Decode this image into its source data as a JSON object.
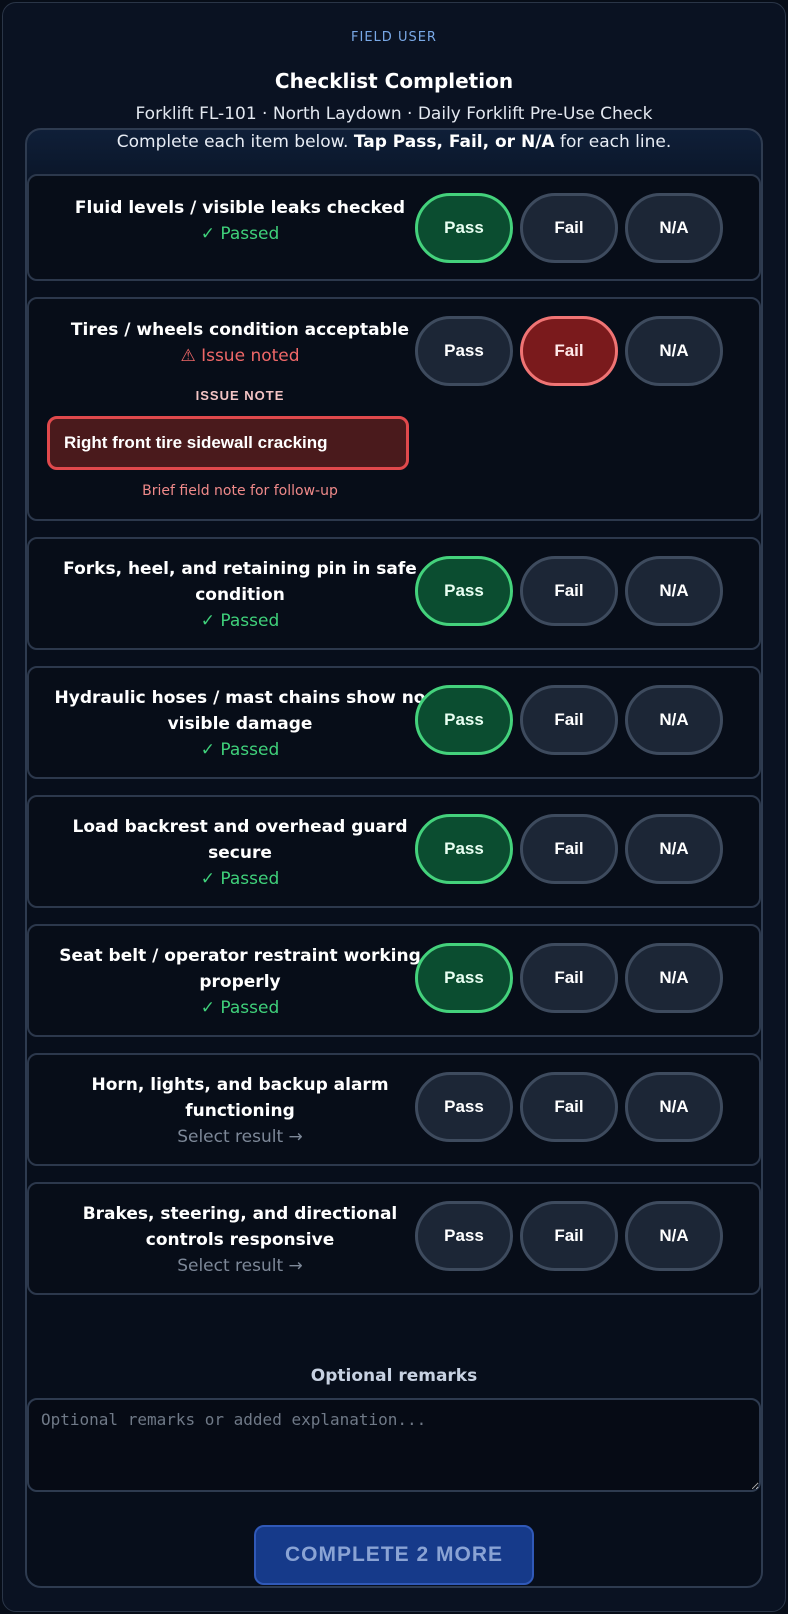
{
  "header": {
    "role": "FIELD USER",
    "title": "Checklist Completion",
    "subtitle": "Forklift FL-101 · North Laydown · Daily Forklift Pre-Use Check"
  },
  "instructions": {
    "lead": "Complete each item below. ",
    "emphasis": "Tap Pass, Fail, or N/A",
    "tail": " for each line."
  },
  "buttons": {
    "pass": "Pass",
    "fail": "Fail",
    "na": "N/A"
  },
  "items": [
    {
      "label": "Fluid levels / visible leaks checked",
      "status": "✓ Passed",
      "result": "pass"
    },
    {
      "label": "Tires / wheels condition acceptable",
      "status": "⚠ Issue noted",
      "result": "fail",
      "issue_label": "ISSUE NOTE",
      "issue_value": "Right front tire sidewall cracking",
      "issue_hint": "Brief field note for follow-up"
    },
    {
      "label": "Forks, heel, and retaining pin in safe condition",
      "status": "✓ Passed",
      "result": "pass"
    },
    {
      "label": "Hydraulic hoses / mast chains show no visible damage",
      "status": "✓ Passed",
      "result": "pass"
    },
    {
      "label": "Load backrest and overhead guard secure",
      "status": "✓ Passed",
      "result": "pass"
    },
    {
      "label": "Seat belt / operator restraint working properly",
      "status": "✓ Passed",
      "result": "pass"
    },
    {
      "label": "Horn, lights, and backup alarm functioning",
      "status": "Select result →",
      "result": "none"
    },
    {
      "label": "Brakes, steering, and directional controls responsive",
      "status": "Select result →",
      "result": "none"
    }
  ],
  "remarks": {
    "label": "Optional remarks",
    "placeholder": "Optional remarks or added explanation...",
    "value": ""
  },
  "submit": {
    "label": "COMPLETE 2 MORE"
  },
  "colors": {
    "pass": "#3fd07a",
    "fail": "#f06868",
    "accent": "#79a8e6",
    "submit": "#163a8a"
  }
}
